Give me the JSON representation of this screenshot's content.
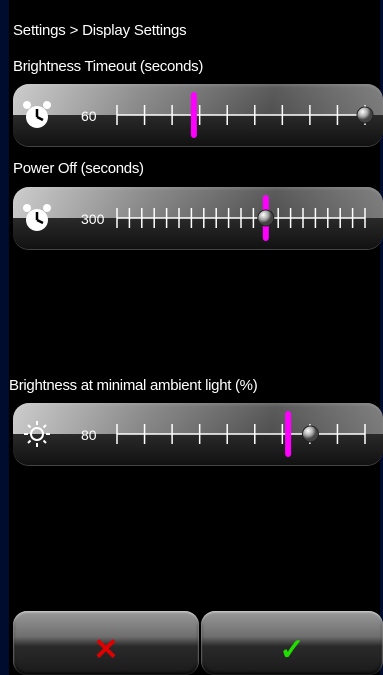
{
  "breadcrumb": "Settings > Display Settings",
  "sliders": [
    {
      "label": "Brightness Timeout (seconds)",
      "value": "60",
      "icon": "alarm-clock-icon",
      "ticks": 10,
      "knob_fraction": 1.0,
      "marker_fraction": 0.31
    },
    {
      "label": "Power Off (seconds)",
      "value": "300",
      "icon": "alarm-clock-icon",
      "ticks": 21,
      "knob_fraction": 0.6,
      "marker_fraction": 0.6
    },
    {
      "label": "Brightness at minimal ambient light (%)",
      "value": "80",
      "icon": "sun-icon",
      "ticks": 10,
      "knob_fraction": 0.78,
      "marker_fraction": 0.69
    }
  ],
  "buttons": {
    "cancel_glyph": "✕",
    "ok_glyph": "✓",
    "cancel_color": "#e00000",
    "ok_color": "#22dd00"
  },
  "colors": {
    "marker": "#ff00ff",
    "frame": "#000c2e"
  }
}
